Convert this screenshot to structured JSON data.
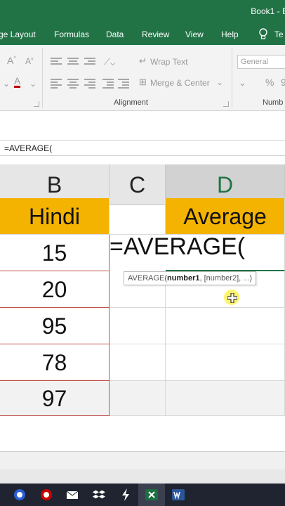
{
  "window": {
    "title": "Book1 - E"
  },
  "ribbon_tabs": [
    "ge Layout",
    "Formulas",
    "Data",
    "Review",
    "View",
    "Help",
    "Te"
  ],
  "ribbon": {
    "wrap_text": "Wrap Text",
    "merge_center": "Merge & Center",
    "number_format": "General",
    "alignment_group": "Alignment",
    "number_group": "Numb",
    "percent": "%",
    "comma": "9"
  },
  "formula_bar": {
    "value": "=AVERAGE("
  },
  "columns": [
    "B",
    "C",
    "D"
  ],
  "headers": {
    "b": "Hindi",
    "d": "Average"
  },
  "values_b": [
    "15",
    "20",
    "95",
    "78",
    "97"
  ],
  "editing_text": "=AVERAGE(",
  "tooltip": {
    "func": "AVERAGE(",
    "arg1": "number1",
    "rest": ", [number2], ...)"
  }
}
